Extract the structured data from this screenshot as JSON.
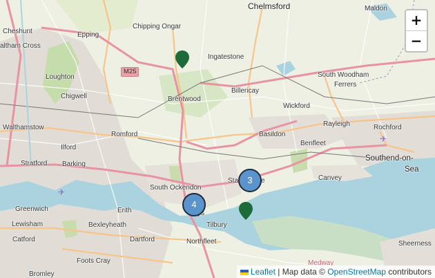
{
  "map": {
    "places": {
      "chelmsford": "Chelmsford",
      "maldon": "Maldon",
      "cheshunt": "Cheshunt",
      "waltham_cross": "altham Cross",
      "epping": "Epping",
      "chipping_ongar": "Chipping Ongar",
      "ingatestone": "Ingatestone",
      "loughton": "Loughton",
      "south_woodham": "South Woodham",
      "ferrers": "Ferrers",
      "chigwell": "Chigwell",
      "brentwood": "Brentwood",
      "billericay": "Billericay",
      "wickford": "Wickford",
      "walthamstow": "Walthamstow",
      "romford": "Romford",
      "basildon": "Basildon",
      "rayleigh": "Rayleigh",
      "rochford": "Rochford",
      "ilford": "Ilford",
      "benfleet": "Benfleet",
      "stratford": "Stratford",
      "barking": "Barking",
      "southend": "Southend-on-",
      "sea": "Sea",
      "canvey": "Canvey",
      "stanford": "Sta",
      "stanford_end": "e",
      "south_ockendon": "South Ockendon",
      "greenwich": "Greenwich",
      "erith": "Erith",
      "lewisham": "Lewisham",
      "bexleyheath": "Bexleyheath",
      "grays": "ys",
      "tilbury": "Tilbury",
      "catford": "Catford",
      "dartford": "Dartford",
      "northfleet": "Northfleet",
      "sheerness": "Sheerness",
      "foots_cray": "Foots Cray",
      "bromley": "Bromley",
      "medway": "Medway"
    },
    "road_shields": {
      "m25": "M25"
    },
    "clusters": [
      {
        "count": "3"
      },
      {
        "count": "4"
      }
    ],
    "zoom": {
      "in": "+",
      "out": "−"
    },
    "attribution": {
      "leaflet": "Leaflet",
      "separator": " | Map data © ",
      "osm": "OpenStreetMap",
      "suffix": " contributors"
    },
    "colors": {
      "cluster": "#5b93cd",
      "marker": "#1e6b3a",
      "water": "#aad3df",
      "motorway": "#e892a2"
    }
  }
}
